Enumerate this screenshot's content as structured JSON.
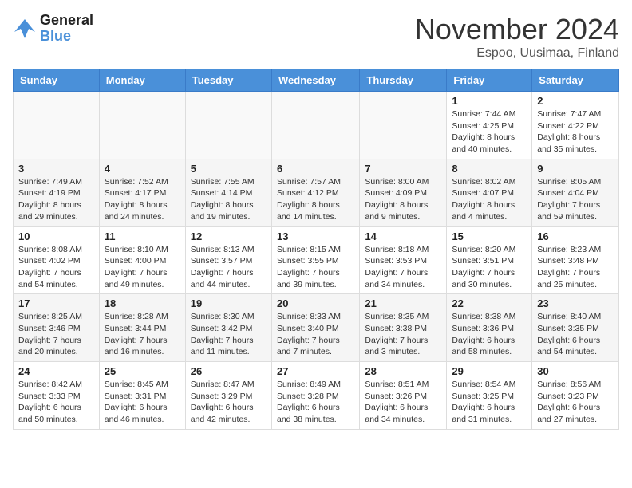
{
  "logo": {
    "line1": "General",
    "line2": "Blue"
  },
  "title": "November 2024",
  "subtitle": "Espoo, Uusimaa, Finland",
  "days_of_week": [
    "Sunday",
    "Monday",
    "Tuesday",
    "Wednesday",
    "Thursday",
    "Friday",
    "Saturday"
  ],
  "weeks": [
    [
      {
        "day": "",
        "info": ""
      },
      {
        "day": "",
        "info": ""
      },
      {
        "day": "",
        "info": ""
      },
      {
        "day": "",
        "info": ""
      },
      {
        "day": "",
        "info": ""
      },
      {
        "day": "1",
        "info": "Sunrise: 7:44 AM\nSunset: 4:25 PM\nDaylight: 8 hours and 40 minutes."
      },
      {
        "day": "2",
        "info": "Sunrise: 7:47 AM\nSunset: 4:22 PM\nDaylight: 8 hours and 35 minutes."
      }
    ],
    [
      {
        "day": "3",
        "info": "Sunrise: 7:49 AM\nSunset: 4:19 PM\nDaylight: 8 hours and 29 minutes."
      },
      {
        "day": "4",
        "info": "Sunrise: 7:52 AM\nSunset: 4:17 PM\nDaylight: 8 hours and 24 minutes."
      },
      {
        "day": "5",
        "info": "Sunrise: 7:55 AM\nSunset: 4:14 PM\nDaylight: 8 hours and 19 minutes."
      },
      {
        "day": "6",
        "info": "Sunrise: 7:57 AM\nSunset: 4:12 PM\nDaylight: 8 hours and 14 minutes."
      },
      {
        "day": "7",
        "info": "Sunrise: 8:00 AM\nSunset: 4:09 PM\nDaylight: 8 hours and 9 minutes."
      },
      {
        "day": "8",
        "info": "Sunrise: 8:02 AM\nSunset: 4:07 PM\nDaylight: 8 hours and 4 minutes."
      },
      {
        "day": "9",
        "info": "Sunrise: 8:05 AM\nSunset: 4:04 PM\nDaylight: 7 hours and 59 minutes."
      }
    ],
    [
      {
        "day": "10",
        "info": "Sunrise: 8:08 AM\nSunset: 4:02 PM\nDaylight: 7 hours and 54 minutes."
      },
      {
        "day": "11",
        "info": "Sunrise: 8:10 AM\nSunset: 4:00 PM\nDaylight: 7 hours and 49 minutes."
      },
      {
        "day": "12",
        "info": "Sunrise: 8:13 AM\nSunset: 3:57 PM\nDaylight: 7 hours and 44 minutes."
      },
      {
        "day": "13",
        "info": "Sunrise: 8:15 AM\nSunset: 3:55 PM\nDaylight: 7 hours and 39 minutes."
      },
      {
        "day": "14",
        "info": "Sunrise: 8:18 AM\nSunset: 3:53 PM\nDaylight: 7 hours and 34 minutes."
      },
      {
        "day": "15",
        "info": "Sunrise: 8:20 AM\nSunset: 3:51 PM\nDaylight: 7 hours and 30 minutes."
      },
      {
        "day": "16",
        "info": "Sunrise: 8:23 AM\nSunset: 3:48 PM\nDaylight: 7 hours and 25 minutes."
      }
    ],
    [
      {
        "day": "17",
        "info": "Sunrise: 8:25 AM\nSunset: 3:46 PM\nDaylight: 7 hours and 20 minutes."
      },
      {
        "day": "18",
        "info": "Sunrise: 8:28 AM\nSunset: 3:44 PM\nDaylight: 7 hours and 16 minutes."
      },
      {
        "day": "19",
        "info": "Sunrise: 8:30 AM\nSunset: 3:42 PM\nDaylight: 7 hours and 11 minutes."
      },
      {
        "day": "20",
        "info": "Sunrise: 8:33 AM\nSunset: 3:40 PM\nDaylight: 7 hours and 7 minutes."
      },
      {
        "day": "21",
        "info": "Sunrise: 8:35 AM\nSunset: 3:38 PM\nDaylight: 7 hours and 3 minutes."
      },
      {
        "day": "22",
        "info": "Sunrise: 8:38 AM\nSunset: 3:36 PM\nDaylight: 6 hours and 58 minutes."
      },
      {
        "day": "23",
        "info": "Sunrise: 8:40 AM\nSunset: 3:35 PM\nDaylight: 6 hours and 54 minutes."
      }
    ],
    [
      {
        "day": "24",
        "info": "Sunrise: 8:42 AM\nSunset: 3:33 PM\nDaylight: 6 hours and 50 minutes."
      },
      {
        "day": "25",
        "info": "Sunrise: 8:45 AM\nSunset: 3:31 PM\nDaylight: 6 hours and 46 minutes."
      },
      {
        "day": "26",
        "info": "Sunrise: 8:47 AM\nSunset: 3:29 PM\nDaylight: 6 hours and 42 minutes."
      },
      {
        "day": "27",
        "info": "Sunrise: 8:49 AM\nSunset: 3:28 PM\nDaylight: 6 hours and 38 minutes."
      },
      {
        "day": "28",
        "info": "Sunrise: 8:51 AM\nSunset: 3:26 PM\nDaylight: 6 hours and 34 minutes."
      },
      {
        "day": "29",
        "info": "Sunrise: 8:54 AM\nSunset: 3:25 PM\nDaylight: 6 hours and 31 minutes."
      },
      {
        "day": "30",
        "info": "Sunrise: 8:56 AM\nSunset: 3:23 PM\nDaylight: 6 hours and 27 minutes."
      }
    ]
  ]
}
